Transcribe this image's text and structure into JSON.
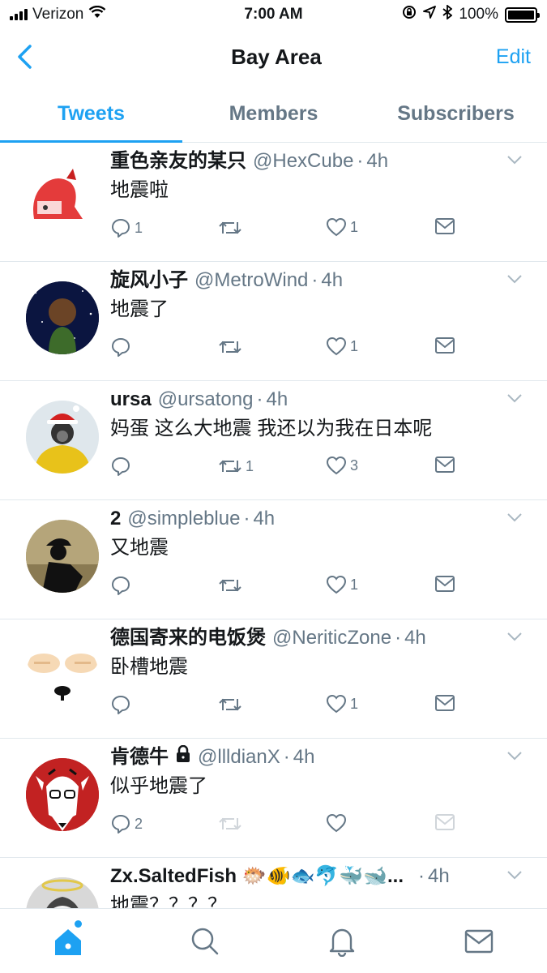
{
  "status_bar": {
    "carrier": "Verizon",
    "time": "7:00 AM",
    "battery": "100%"
  },
  "nav": {
    "title": "Bay Area",
    "edit_label": "Edit"
  },
  "tabs": [
    {
      "label": "Tweets",
      "active": true
    },
    {
      "label": "Members",
      "active": false
    },
    {
      "label": "Subscribers",
      "active": false
    }
  ],
  "tweets": [
    {
      "name": "重色亲友的某只",
      "handle": "@HexCube",
      "time": "4h",
      "text": "地震啦",
      "replies": "1",
      "retweets": "",
      "likes": "1",
      "protected": false
    },
    {
      "name": "旋风小子",
      "handle": "@MetroWind",
      "time": "4h",
      "text": "地震了",
      "replies": "",
      "retweets": "",
      "likes": "1",
      "protected": false
    },
    {
      "name": "ursa",
      "handle": "@ursatong",
      "time": "4h",
      "text": "妈蛋 这么大地震 我还以为我在日本呢",
      "replies": "",
      "retweets": "1",
      "likes": "3",
      "protected": false
    },
    {
      "name": "2",
      "handle": "@simpleblue",
      "time": "4h",
      "text": "又地震",
      "replies": "",
      "retweets": "",
      "likes": "1",
      "protected": false
    },
    {
      "name": "德国寄来的电饭煲",
      "handle": "@NeriticZone",
      "time": "4h",
      "text": "卧槽地震",
      "replies": "",
      "retweets": "",
      "likes": "1",
      "protected": false
    },
    {
      "name": "肯德牛",
      "handle": "@llldianX",
      "time": "4h",
      "text": "似乎地震了",
      "replies": "2",
      "retweets": "",
      "likes": "",
      "protected": true
    },
    {
      "name": "Zx.SaltedFish 🐡🐠🐟🐬🐳🐋...",
      "handle": "",
      "time": "4h",
      "text": "地震？？？？",
      "replies": "",
      "retweets": "",
      "likes": "",
      "protected": false
    }
  ],
  "colors": {
    "accent": "#1da1f2",
    "secondary_text": "#657786",
    "divider": "#e1e8ed"
  }
}
